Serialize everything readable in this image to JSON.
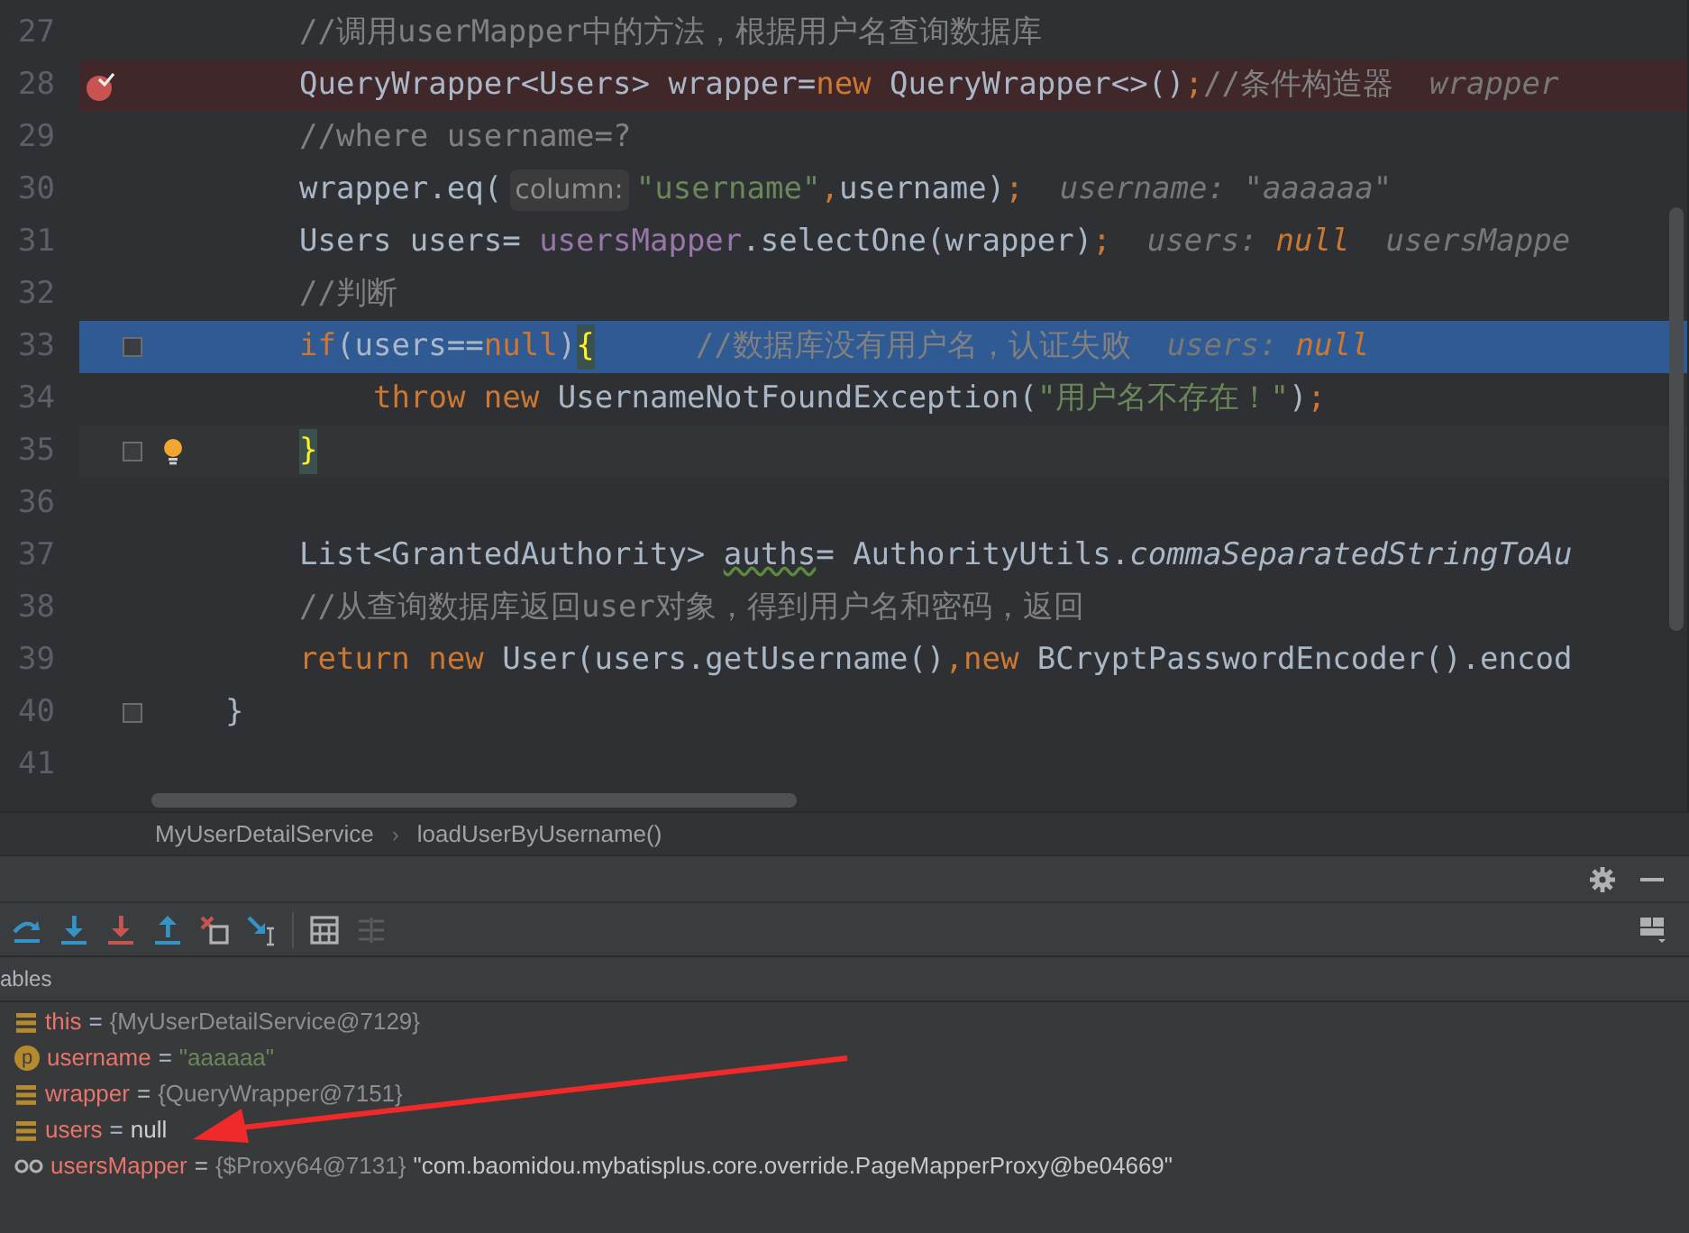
{
  "editor": {
    "lines": [
      {
        "number": "27",
        "in_method": true,
        "in_block": false,
        "kind": "normal",
        "breakpoint": false,
        "fold": false,
        "intention_bulb": false,
        "tokens": [
          {
            "kind": "comment",
            "text": "//调用userMapper中的方法，根据用户名查询数据库"
          }
        ]
      },
      {
        "number": "28",
        "in_method": true,
        "in_block": false,
        "kind": "breakpoint",
        "breakpoint": true,
        "fold": false,
        "intention_bulb": false,
        "tokens": [
          {
            "kind": "plain",
            "text": "QueryWrapper<Users> wrapper="
          },
          {
            "kind": "keyword",
            "text": "new"
          },
          {
            "kind": "plain",
            "text": " QueryWrapper<>()"
          },
          {
            "kind": "keyword",
            "text": ";"
          },
          {
            "kind": "comment",
            "text": "//条件构造器"
          },
          {
            "kind": "debug_hint",
            "text": "wrapper"
          }
        ]
      },
      {
        "number": "29",
        "in_method": true,
        "in_block": false,
        "kind": "normal",
        "breakpoint": false,
        "fold": false,
        "intention_bulb": false,
        "tokens": [
          {
            "kind": "comment",
            "text": "//where username=?"
          }
        ]
      },
      {
        "number": "30",
        "in_method": true,
        "in_block": false,
        "kind": "normal",
        "breakpoint": false,
        "fold": false,
        "intention_bulb": false,
        "tokens": [
          {
            "kind": "plain",
            "text": "wrapper.eq("
          },
          {
            "kind": "param_hint",
            "text": "column:"
          },
          {
            "kind": "string",
            "text": "\"username\""
          },
          {
            "kind": "keyword",
            "text": ","
          },
          {
            "kind": "plain",
            "text": "username)"
          },
          {
            "kind": "keyword",
            "text": ";"
          },
          {
            "kind": "debug_hint",
            "text": "username: \"aaaaaa\""
          }
        ]
      },
      {
        "number": "31",
        "in_method": true,
        "in_block": false,
        "kind": "normal",
        "breakpoint": false,
        "fold": false,
        "intention_bulb": false,
        "tokens": [
          {
            "kind": "plain",
            "text": "Users users= "
          },
          {
            "kind": "field",
            "text": "usersMapper"
          },
          {
            "kind": "plain",
            "text": ".selectOne(wrapper)"
          },
          {
            "kind": "keyword",
            "text": ";"
          },
          {
            "kind": "debug_hint",
            "text": "users:"
          },
          {
            "kind": "debug_null",
            "text": "null"
          },
          {
            "kind": "debug_hint",
            "text": "usersMappe"
          }
        ]
      },
      {
        "number": "32",
        "in_method": true,
        "in_block": false,
        "kind": "normal",
        "breakpoint": false,
        "fold": false,
        "intention_bulb": false,
        "tokens": [
          {
            "kind": "comment",
            "text": "//判断"
          }
        ]
      },
      {
        "number": "33",
        "in_method": true,
        "in_block": false,
        "kind": "execution",
        "breakpoint": false,
        "fold": true,
        "intention_bulb": false,
        "tokens": [
          {
            "kind": "keyword",
            "text": "if"
          },
          {
            "kind": "plain",
            "text": "(users=="
          },
          {
            "kind": "keyword",
            "text": "null"
          },
          {
            "kind": "plain",
            "text": ")"
          },
          {
            "kind": "brace_match",
            "text": "{"
          },
          {
            "kind": "comment_gap",
            "text": "//数据库没有用户名，认证失败"
          },
          {
            "kind": "debug_hint",
            "text": "users:"
          },
          {
            "kind": "debug_null",
            "text": "null"
          }
        ]
      },
      {
        "number": "34",
        "in_method": true,
        "in_block": true,
        "kind": "normal",
        "breakpoint": false,
        "fold": false,
        "intention_bulb": false,
        "tokens": [
          {
            "kind": "keyword",
            "text": "throw new"
          },
          {
            "kind": "plain",
            "text": " UsernameNotFoundException("
          },
          {
            "kind": "string",
            "text": "\"用户名不存在！\""
          },
          {
            "kind": "plain",
            "text": ")"
          },
          {
            "kind": "keyword",
            "text": ";"
          }
        ]
      },
      {
        "number": "35",
        "in_method": true,
        "in_block": false,
        "kind": "caret",
        "breakpoint": false,
        "fold": true,
        "intention_bulb": true,
        "tokens": [
          {
            "kind": "brace_match",
            "text": "}"
          }
        ]
      },
      {
        "number": "36",
        "kind": "normal",
        "breakpoint": false,
        "fold": false,
        "intention_bulb": false
      },
      {
        "number": "37",
        "in_method": true,
        "in_block": false,
        "kind": "normal",
        "breakpoint": false,
        "fold": false,
        "intention_bulb": false,
        "tokens": [
          {
            "kind": "plain",
            "text": "List<GrantedAuthority> "
          },
          {
            "kind": "warning",
            "text": "auths"
          },
          {
            "kind": "plain",
            "text": "= AuthorityUtils."
          },
          {
            "kind": "static",
            "text": "commaSeparatedStringToAu"
          }
        ]
      },
      {
        "number": "38",
        "in_method": true,
        "in_block": false,
        "kind": "normal",
        "breakpoint": false,
        "fold": false,
        "intention_bulb": false,
        "tokens": [
          {
            "kind": "comment",
            "text": "//从查询数据库返回user对象，得到用户名和密码，返回"
          }
        ]
      },
      {
        "number": "39",
        "in_method": true,
        "in_block": false,
        "kind": "normal",
        "breakpoint": false,
        "fold": false,
        "intention_bulb": false,
        "tokens": [
          {
            "kind": "keyword",
            "text": "return new"
          },
          {
            "kind": "plain",
            "text": " User(users.getUsername()"
          },
          {
            "kind": "keyword",
            "text": ",new"
          },
          {
            "kind": "plain",
            "text": " BCryptPasswordEncoder().encod"
          }
        ]
      },
      {
        "number": "40",
        "in_method": false,
        "in_block": false,
        "kind": "normal",
        "breakpoint": false,
        "fold": true,
        "intention_bulb": false,
        "tokens": [
          {
            "kind": "plain",
            "text": "}"
          }
        ]
      },
      {
        "number": "41",
        "kind": "normal",
        "breakpoint": false,
        "fold": false,
        "intention_bulb": false
      }
    ]
  },
  "breadcrumbs": {
    "separator": "›",
    "items": [
      "MyUserDetailService",
      "loadUserByUsername()"
    ]
  },
  "debug_toolbar": [
    {
      "kind": "step_over",
      "disabled": false
    },
    {
      "kind": "step_into",
      "disabled": false
    },
    {
      "kind": "force_step_into",
      "disabled": false
    },
    {
      "kind": "step_out",
      "disabled": false
    },
    {
      "kind": "drop_frame",
      "disabled": false
    },
    {
      "kind": "run_to_cursor",
      "disabled": false
    },
    {
      "kind": "evaluate",
      "disabled": false
    },
    {
      "kind": "trace",
      "disabled": true
    }
  ],
  "variables": {
    "title": "ables",
    "items": [
      {
        "kind": "field",
        "name": "this",
        "operator": "=",
        "value": [
          {
            "kind": "object",
            "text": "{MyUserDetailService@7129}"
          }
        ]
      },
      {
        "kind": "parameter",
        "badge": "p",
        "name": "username",
        "operator": "=",
        "value": [
          {
            "kind": "string",
            "text": "\"aaaaaa\""
          }
        ]
      },
      {
        "kind": "field",
        "name": "wrapper",
        "operator": "=",
        "value": [
          {
            "kind": "object",
            "text": "{QueryWrapper@7151}"
          }
        ]
      },
      {
        "kind": "field",
        "name": "users",
        "operator": "=",
        "value": [
          {
            "kind": "null",
            "text": "null"
          }
        ]
      },
      {
        "kind": "watch",
        "name": "usersMapper",
        "operator": "=",
        "value": [
          {
            "kind": "object",
            "text": "{$Proxy64@7131}"
          },
          {
            "kind": "detail",
            "text": "\"com.baomidou.mybatisplus.core.override.PageMapperProxy@be04669\""
          }
        ]
      }
    ]
  }
}
